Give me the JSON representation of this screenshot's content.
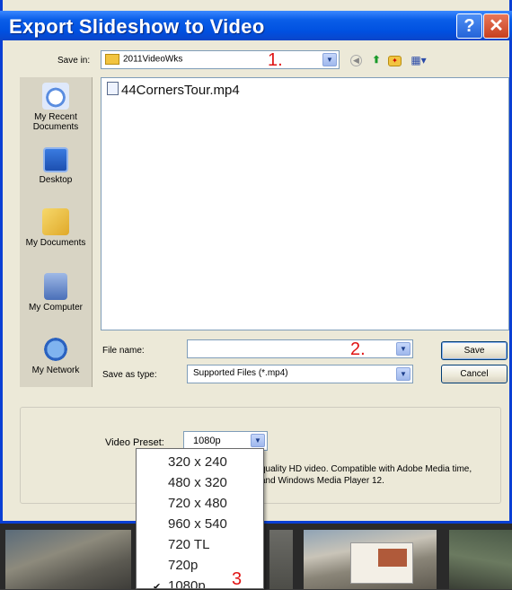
{
  "window": {
    "title": "Export Slideshow to Video",
    "help_label": "?",
    "close_label": "✕"
  },
  "save_in": {
    "label": "Save in:",
    "value": "2011VideoWks"
  },
  "places": [
    {
      "name": "my-recent-documents",
      "label": "My Recent Documents",
      "icon": "recent-documents-icon"
    },
    {
      "name": "desktop",
      "label": "Desktop",
      "icon": "desktop-icon"
    },
    {
      "name": "my-documents",
      "label": "My Documents",
      "icon": "my-documents-icon"
    },
    {
      "name": "my-computer",
      "label": "My Computer",
      "icon": "my-computer-icon"
    },
    {
      "name": "my-network",
      "label": "My Network",
      "icon": "my-network-icon"
    }
  ],
  "files": [
    {
      "name": "44CornersTour.mp4"
    }
  ],
  "file_name": {
    "label": "File name:",
    "value": ""
  },
  "save_as_type": {
    "label": "Save as type:",
    "value": "Supported Files (*.mp4)"
  },
  "buttons": {
    "save": "Save",
    "cancel": "Cancel"
  },
  "video_preset": {
    "label": "Video Preset:",
    "value": "1080p"
  },
  "description": "quality HD video. Compatible with Adobe Media time, and Windows Media Player 12.",
  "preset_options": [
    "320 x 240",
    "480 x 320",
    "720 x 480",
    "960 x 540",
    "720 TL",
    "720p",
    "1080p"
  ],
  "preset_checked_index": 6,
  "annotations": {
    "one": "1.",
    "two": "2.",
    "three": "3"
  },
  "colors": {
    "title_bar": "#0050e0",
    "annotation": "#e01515",
    "dialog_bg": "#ece9d8"
  }
}
